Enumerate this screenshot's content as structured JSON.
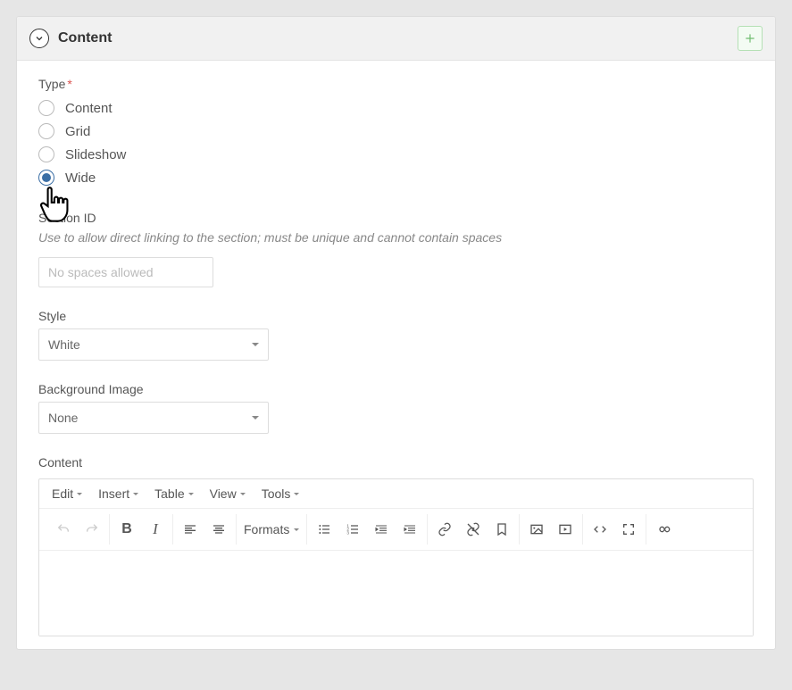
{
  "panel": {
    "title": "Content"
  },
  "type": {
    "label": "Type",
    "required_mark": "*",
    "options": [
      "Content",
      "Grid",
      "Slideshow",
      "Wide"
    ],
    "selected_index": 3
  },
  "section_id": {
    "label": "Section ID",
    "hint": "Use to allow direct linking to the section; must be unique and cannot contain spaces",
    "placeholder": "No spaces allowed",
    "value": ""
  },
  "style": {
    "label": "Style",
    "value": "White"
  },
  "background_image": {
    "label": "Background Image",
    "value": "None"
  },
  "content": {
    "label": "Content",
    "menubar": [
      "Edit",
      "Insert",
      "Table",
      "View",
      "Tools"
    ],
    "formats_label": "Formats"
  }
}
